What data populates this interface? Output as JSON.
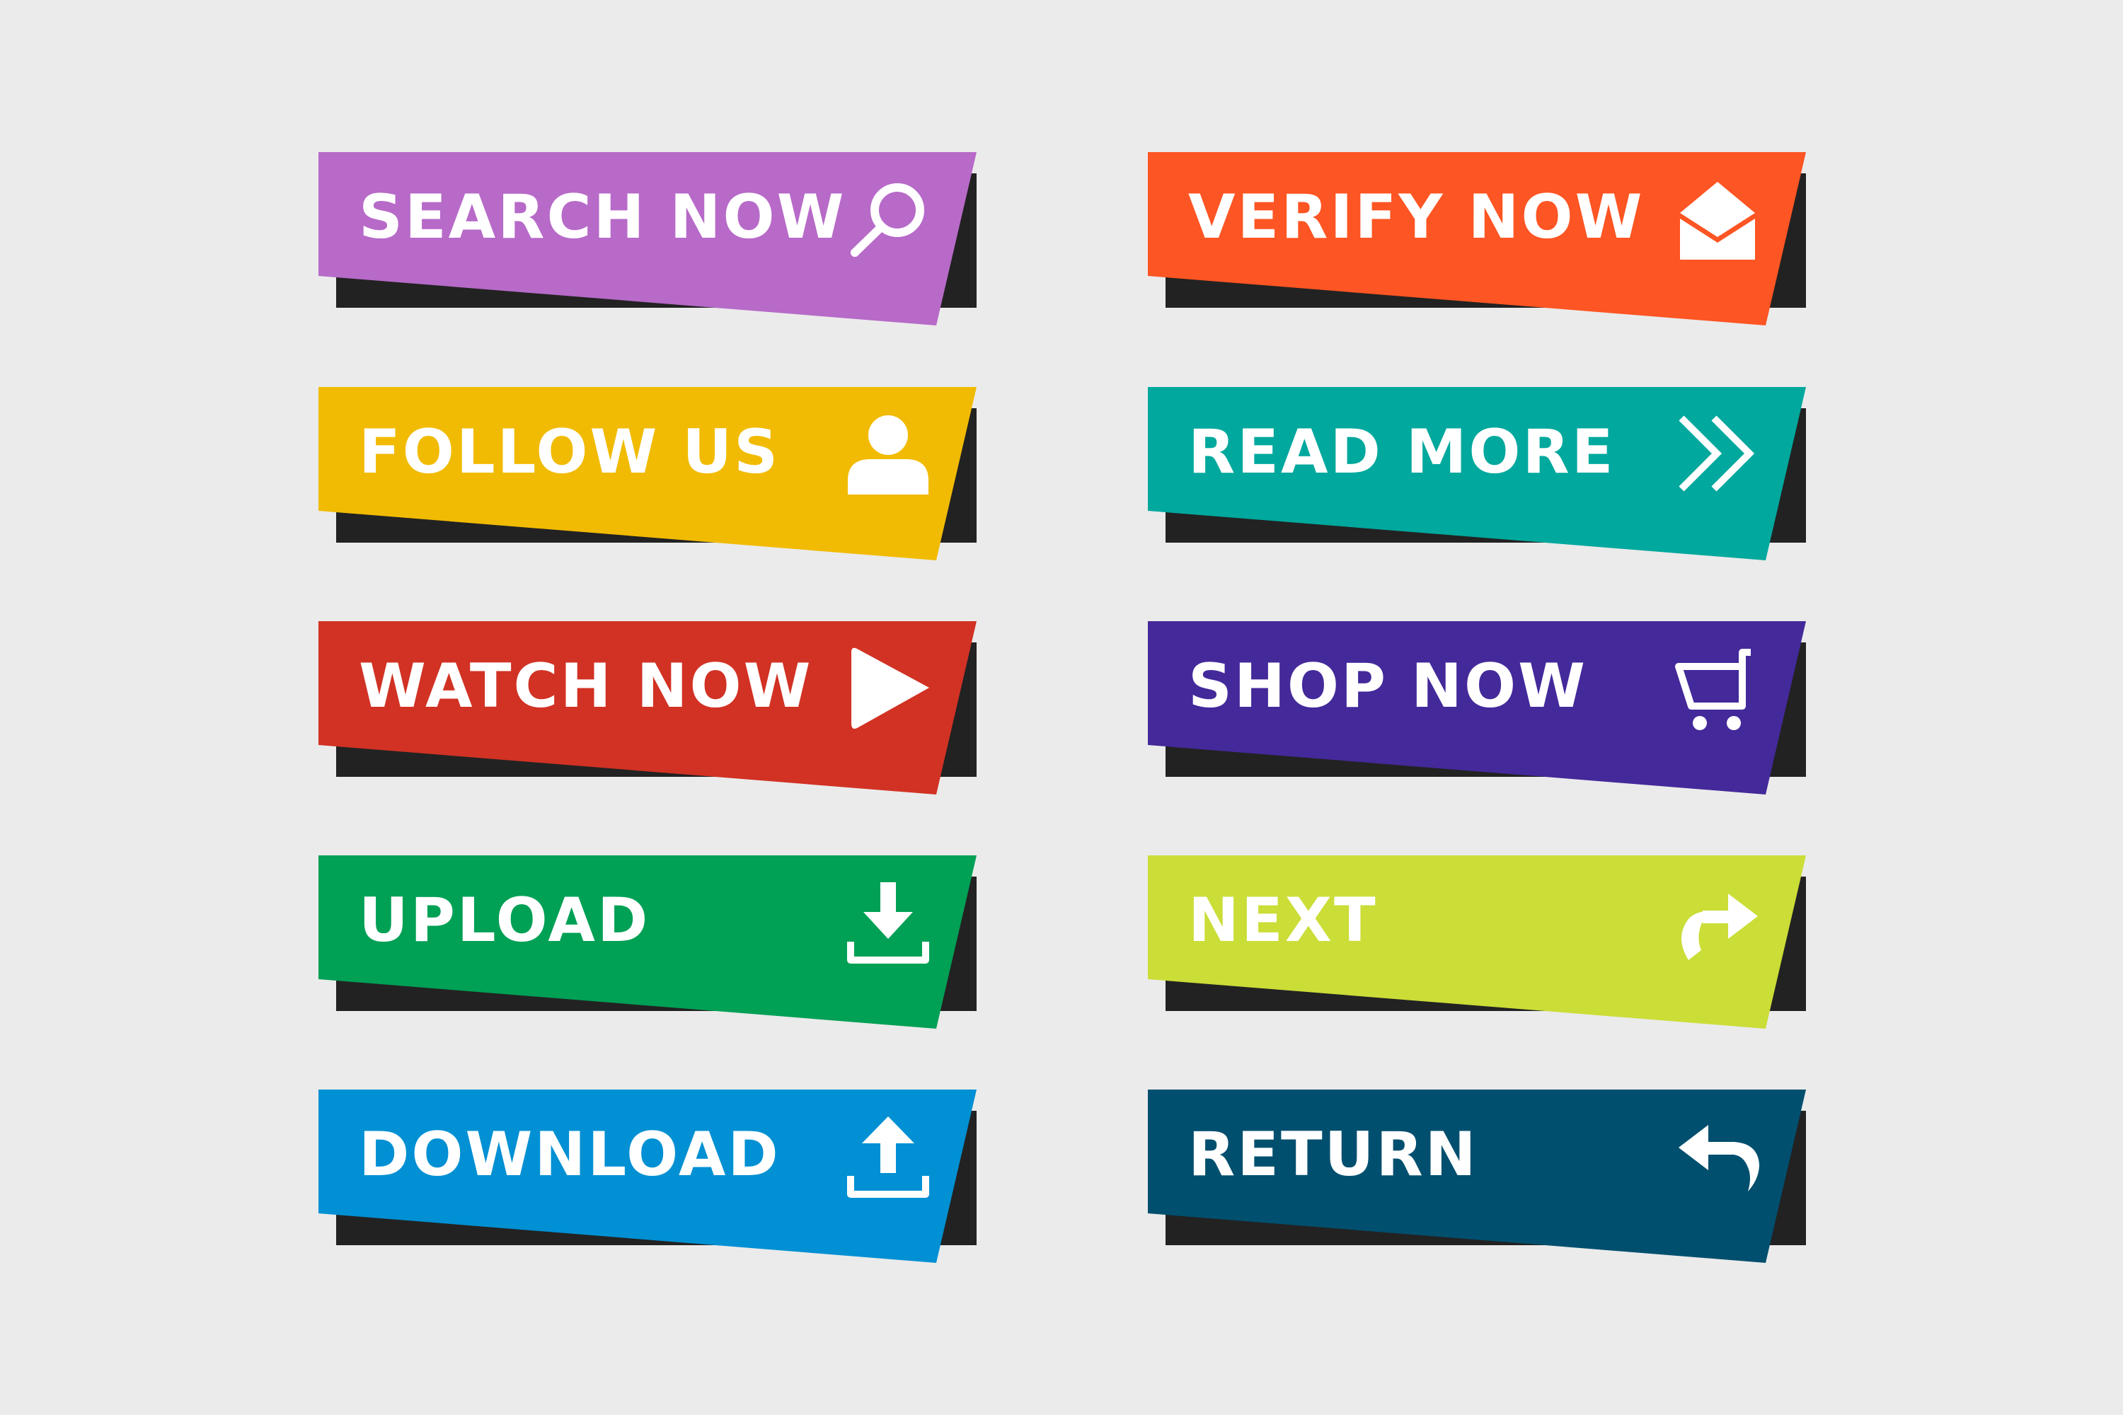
{
  "buttons": [
    {
      "id": "search-now",
      "label": "SEARCH NOW",
      "color": "#b76ac8",
      "icon": "search-icon"
    },
    {
      "id": "verify-now",
      "label": "VERIFY NOW",
      "color": "#fd5523",
      "icon": "envelope-icon"
    },
    {
      "id": "follow-us",
      "label": "FOLLOW US",
      "color": "#f1bb03",
      "icon": "user-icon"
    },
    {
      "id": "read-more",
      "label": "READ MORE",
      "color": "#00a89d",
      "icon": "double-chevron-right-icon"
    },
    {
      "id": "watch-now",
      "label": "WATCH NOW",
      "color": "#d13224",
      "icon": "play-icon"
    },
    {
      "id": "shop-now",
      "label": "SHOP NOW",
      "color": "#44299a",
      "icon": "cart-icon"
    },
    {
      "id": "upload",
      "label": "UPLOAD",
      "color": "#00a055",
      "icon": "download-tray-icon"
    },
    {
      "id": "next",
      "label": "NEXT",
      "color": "#cbdd37",
      "icon": "forward-arrow-icon"
    },
    {
      "id": "download",
      "label": "DOWNLOAD",
      "color": "#0090d3",
      "icon": "upload-tray-icon"
    },
    {
      "id": "return",
      "label": "RETURN",
      "color": "#004f6f",
      "icon": "return-arrow-icon"
    }
  ],
  "colors": {
    "background": "#ebebeb",
    "shadow": "#222222",
    "text": "#ffffff"
  }
}
